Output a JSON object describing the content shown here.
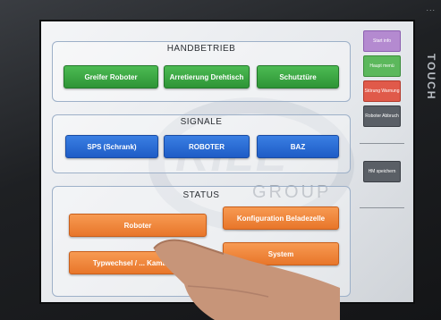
{
  "device": {
    "bezel_label": "...",
    "touch_label": "TOUCH"
  },
  "watermark": {
    "logo": "RILE",
    "group": "GROUP"
  },
  "handbetrieb": {
    "title": "HANDBETRIEB",
    "buttons": [
      "Greifer Roboter",
      "Arretierung Drehtisch",
      "Schutztüre"
    ]
  },
  "signale": {
    "title": "SIGNALE",
    "buttons": [
      "SPS (Schrank)",
      "ROBOTER",
      "BAZ"
    ]
  },
  "status": {
    "title": "STATUS",
    "buttons": [
      "Roboter",
      "Konfiguration Beladezelle",
      "Typwechsel / ... Kamaration",
      "System"
    ]
  },
  "side_menu": {
    "items": [
      {
        "label": "Start info",
        "color": "#b48ad0"
      },
      {
        "label": "Haupt menü",
        "color": "#5cb85c"
      },
      {
        "label": "Störung Warnung",
        "color": "#e05a4a"
      },
      {
        "label": "Roboter Abbruch",
        "color": "#5a5f66"
      },
      {
        "label": "HM speichern",
        "color": "#5a5f66"
      }
    ]
  },
  "colors": {
    "green": "#3aa442",
    "blue": "#2c6fd6",
    "orange": "#f0883a",
    "screen": "#eceef1"
  }
}
